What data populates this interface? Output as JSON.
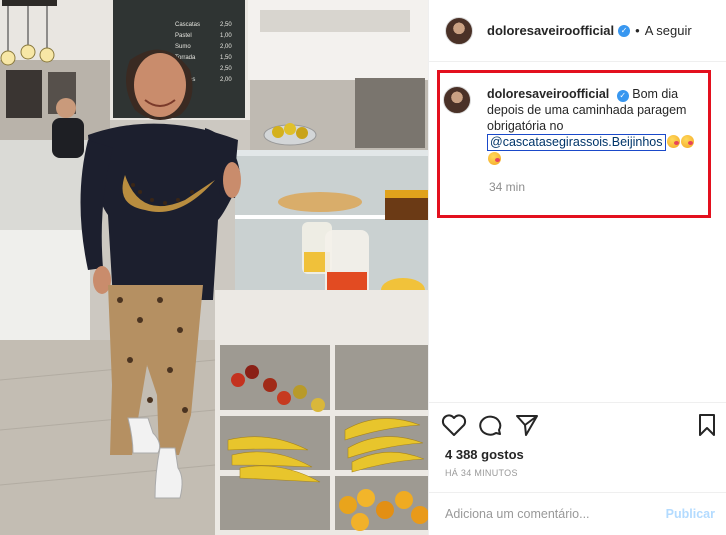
{
  "header": {
    "username": "doloresaveiroofficial",
    "separator": "•",
    "follow_label": "A seguir"
  },
  "caption": {
    "username": "doloresaveiroofficial",
    "text_before": "Bom dia depois de uma caminhada paragem obrigatória no",
    "mention": "@cascatasegirassois.Beijinhos",
    "time": "34 min"
  },
  "actions": {
    "likes": "4 388 gostos",
    "date": "HÁ 34 MINUTOS"
  },
  "comment": {
    "placeholder": "Adiciona um comentário...",
    "post_label": "Publicar"
  },
  "icons": {
    "like": "heart-icon",
    "comment": "speech-bubble-icon",
    "share": "paper-plane-icon",
    "save": "bookmark-icon",
    "verified": "verified-badge-icon"
  },
  "colors": {
    "highlight": "#e3101e",
    "verified": "#3897f0",
    "mention_border": "#1a49c9",
    "post_button": "#b3dbff"
  },
  "chalkboard": {
    "lines": [
      "Cascatas",
      "Pastel",
      "Sumo",
      "Torrada",
      "Bolo",
      "Sandes"
    ],
    "prices": [
      "2,50",
      "1,00",
      "2,00",
      "1,50",
      "2,50",
      "2,00"
    ]
  }
}
